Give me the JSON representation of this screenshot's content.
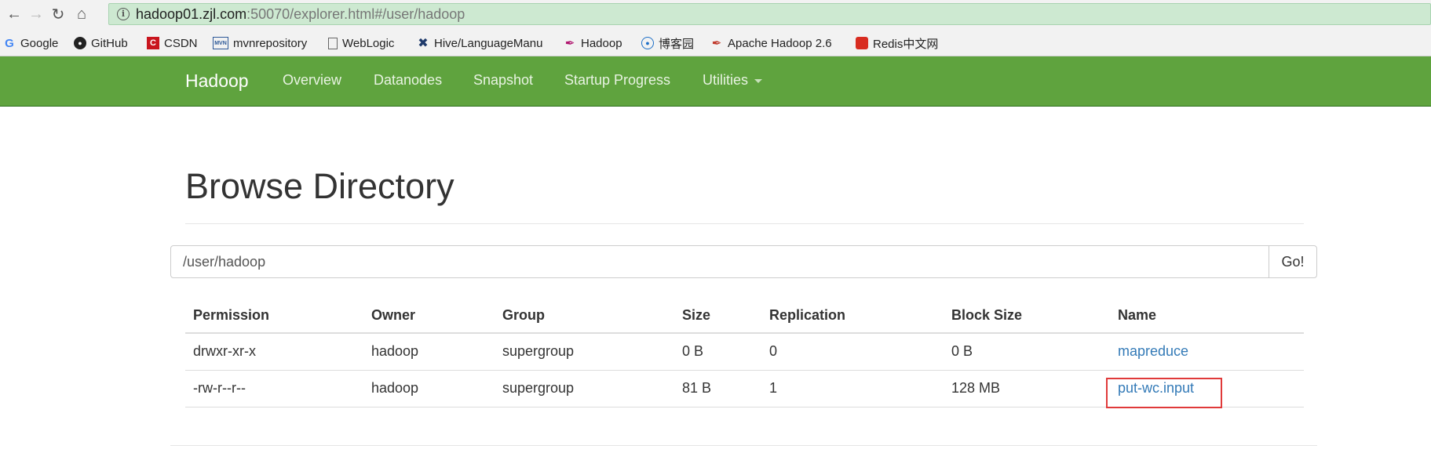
{
  "browser": {
    "url_host": "hadoop01.zjl.com",
    "url_rest": ":50070/explorer.html#/user/hadoop",
    "bookmarks": [
      {
        "label": "Google",
        "icon": "google-icon"
      },
      {
        "label": "GitHub",
        "icon": "github-icon"
      },
      {
        "label": "CSDN",
        "icon": "csdn-icon"
      },
      {
        "label": "mvnrepository",
        "icon": "mvn-icon"
      },
      {
        "label": "WebLogic",
        "icon": "page-icon"
      },
      {
        "label": "Hive/LanguageManu",
        "icon": "hive-icon"
      },
      {
        "label": "Hadoop",
        "icon": "feather-icon"
      },
      {
        "label": "博客园",
        "icon": "cnblogs-icon"
      },
      {
        "label": "Apache Hadoop 2.6",
        "icon": "feather-icon"
      },
      {
        "label": "Redis中文网",
        "icon": "redis-icon"
      }
    ]
  },
  "navbar": {
    "brand": "Hadoop",
    "items": [
      "Overview",
      "Datanodes",
      "Snapshot",
      "Startup Progress",
      "Utilities"
    ]
  },
  "page": {
    "title": "Browse Directory",
    "path_value": "/user/hadoop",
    "go_label": "Go!"
  },
  "table": {
    "headers": [
      "Permission",
      "Owner",
      "Group",
      "Size",
      "Replication",
      "Block Size",
      "Name"
    ],
    "rows": [
      [
        "drwxr-xr-x",
        "hadoop",
        "supergroup",
        "0 B",
        "0",
        "0 B",
        "mapreduce"
      ],
      [
        "-rw-r--r--",
        "hadoop",
        "supergroup",
        "81 B",
        "1",
        "128 MB",
        "put-wc.input"
      ]
    ]
  },
  "colors": {
    "navbar": "#5fa33e",
    "link": "#337ab7",
    "highlight": "#e03a3a",
    "omnibox": "#cde9d1"
  }
}
